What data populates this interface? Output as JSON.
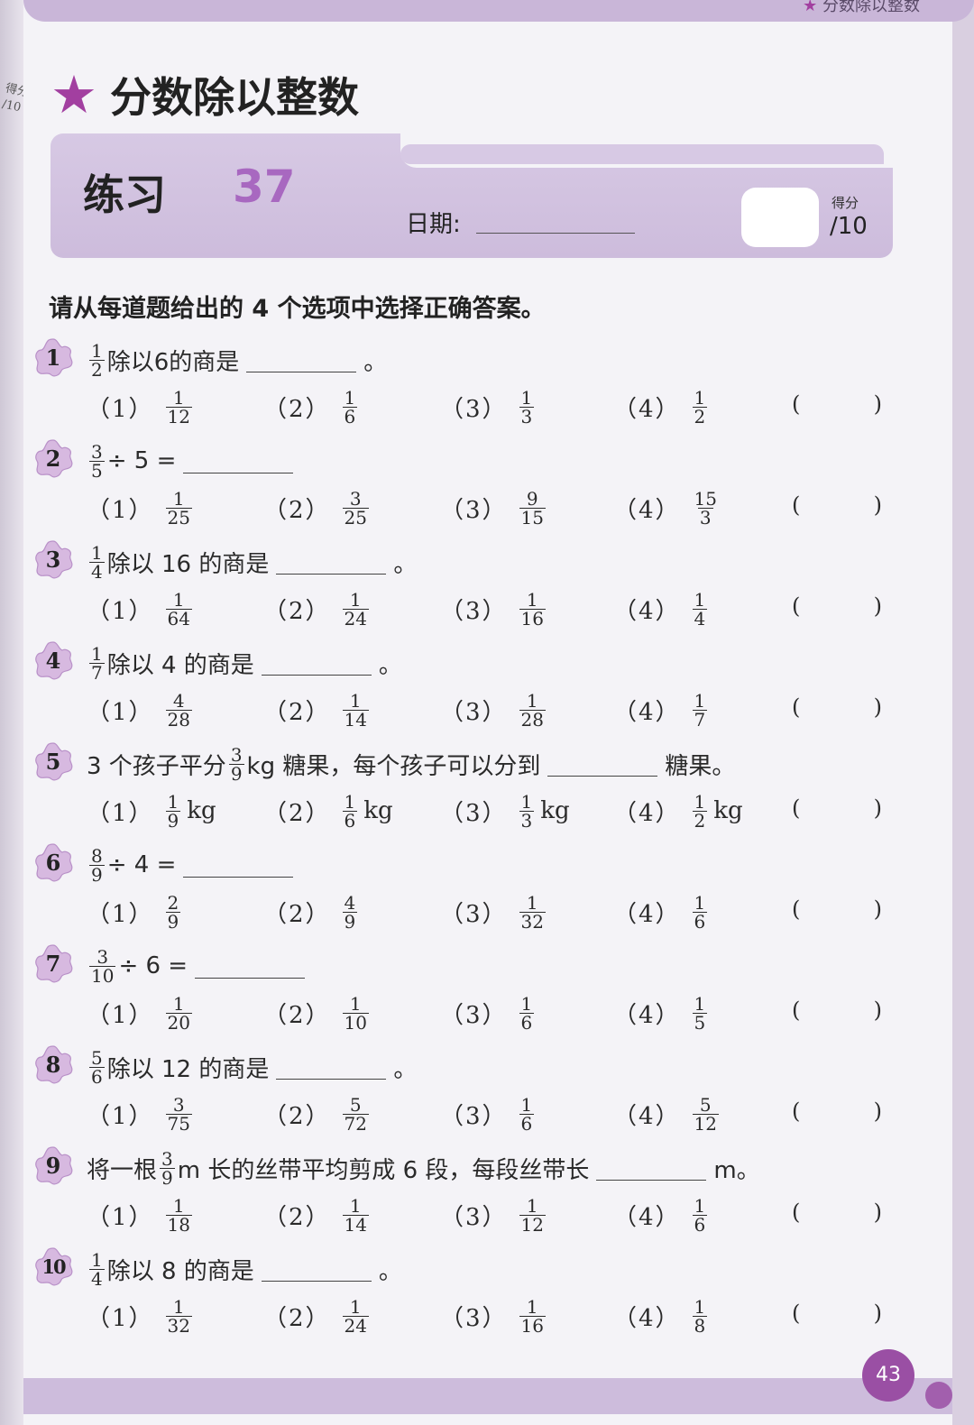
{
  "running_head": "分数除以整数",
  "spine": {
    "score_label": "得分",
    "score_total": "/10"
  },
  "title": "分数除以整数",
  "practice": {
    "label": "练习",
    "number": "37"
  },
  "date_label": "日期:",
  "score": {
    "label": "得分",
    "total": "/10"
  },
  "instruction": "请从每道题给出的 4 个选项中选择正确答案。",
  "questions": [
    {
      "num": "1",
      "frac": {
        "n": "1",
        "d": "2"
      },
      "text": "除以6的商是",
      "end": "。",
      "options": [
        {
          "no": "（1）",
          "n": "1",
          "d": "12"
        },
        {
          "no": "（2）",
          "n": "1",
          "d": "6"
        },
        {
          "no": "（3）",
          "n": "1",
          "d": "3"
        },
        {
          "no": "（4）",
          "n": "1",
          "d": "2"
        }
      ]
    },
    {
      "num": "2",
      "frac": {
        "n": "3",
        "d": "5"
      },
      "text": "÷ 5 =",
      "end": "",
      "options": [
        {
          "no": "（1）",
          "n": "1",
          "d": "25"
        },
        {
          "no": "（2）",
          "n": "3",
          "d": "25"
        },
        {
          "no": "（3）",
          "n": "9",
          "d": "15"
        },
        {
          "no": "（4）",
          "n": "15",
          "d": "3"
        }
      ]
    },
    {
      "num": "3",
      "frac": {
        "n": "1",
        "d": "4"
      },
      "text": "除以 16 的商是",
      "end": "。",
      "options": [
        {
          "no": "（1）",
          "n": "1",
          "d": "64"
        },
        {
          "no": "（2）",
          "n": "1",
          "d": "24"
        },
        {
          "no": "（3）",
          "n": "1",
          "d": "16"
        },
        {
          "no": "（4）",
          "n": "1",
          "d": "4"
        }
      ]
    },
    {
      "num": "4",
      "frac": {
        "n": "1",
        "d": "7"
      },
      "text": "除以 4 的商是",
      "end": "。",
      "options": [
        {
          "no": "（1）",
          "n": "4",
          "d": "28"
        },
        {
          "no": "（2）",
          "n": "1",
          "d": "14"
        },
        {
          "no": "（3）",
          "n": "1",
          "d": "28"
        },
        {
          "no": "（4）",
          "n": "1",
          "d": "7"
        }
      ]
    },
    {
      "num": "5",
      "pre": "3 个孩子平分",
      "frac": {
        "n": "3",
        "d": "9"
      },
      "text": "kg 糖果，每个孩子可以分到",
      "end": "糖果。",
      "unit": "kg",
      "options": [
        {
          "no": "（1）",
          "n": "1",
          "d": "9"
        },
        {
          "no": "（2）",
          "n": "1",
          "d": "6"
        },
        {
          "no": "（3）",
          "n": "1",
          "d": "3"
        },
        {
          "no": "（4）",
          "n": "1",
          "d": "2"
        }
      ]
    },
    {
      "num": "6",
      "frac": {
        "n": "8",
        "d": "9"
      },
      "text": "÷ 4 =",
      "end": "",
      "options": [
        {
          "no": "（1）",
          "n": "2",
          "d": "9"
        },
        {
          "no": "（2）",
          "n": "4",
          "d": "9"
        },
        {
          "no": "（3）",
          "n": "1",
          "d": "32"
        },
        {
          "no": "（4）",
          "n": "1",
          "d": "6"
        }
      ]
    },
    {
      "num": "7",
      "frac": {
        "n": "3",
        "d": "10"
      },
      "text": "÷ 6 =",
      "end": "",
      "options": [
        {
          "no": "（1）",
          "n": "1",
          "d": "20"
        },
        {
          "no": "（2）",
          "n": "1",
          "d": "10"
        },
        {
          "no": "（3）",
          "n": "1",
          "d": "6"
        },
        {
          "no": "（4）",
          "n": "1",
          "d": "5"
        }
      ]
    },
    {
      "num": "8",
      "frac": {
        "n": "5",
        "d": "6"
      },
      "text": "除以 12 的商是",
      "end": "。",
      "options": [
        {
          "no": "（1）",
          "n": "3",
          "d": "75"
        },
        {
          "no": "（2）",
          "n": "5",
          "d": "72"
        },
        {
          "no": "（3）",
          "n": "1",
          "d": "6"
        },
        {
          "no": "（4）",
          "n": "5",
          "d": "12"
        }
      ]
    },
    {
      "num": "9",
      "pre": "将一根",
      "frac": {
        "n": "3",
        "d": "9"
      },
      "text": "m 长的丝带平均剪成 6 段，每段丝带长",
      "end": "m。",
      "options": [
        {
          "no": "（1）",
          "n": "1",
          "d": "18"
        },
        {
          "no": "（2）",
          "n": "1",
          "d": "14"
        },
        {
          "no": "（3）",
          "n": "1",
          "d": "12"
        },
        {
          "no": "（4）",
          "n": "1",
          "d": "6"
        }
      ]
    },
    {
      "num": "10",
      "frac": {
        "n": "1",
        "d": "4"
      },
      "text": "除以 8 的商是",
      "end": "。",
      "options": [
        {
          "no": "（1）",
          "n": "1",
          "d": "32"
        },
        {
          "no": "（2）",
          "n": "1",
          "d": "24"
        },
        {
          "no": "（3）",
          "n": "1",
          "d": "16"
        },
        {
          "no": "（4）",
          "n": "1",
          "d": "8"
        }
      ]
    }
  ],
  "answer_parens": {
    "open": "(",
    "close": ")"
  },
  "page_number": "43",
  "colors": {
    "accent": "#a23fa0",
    "band": "#d7c9e4",
    "practice_num": "#a868c0",
    "page_badge": "#9a4fa4"
  }
}
